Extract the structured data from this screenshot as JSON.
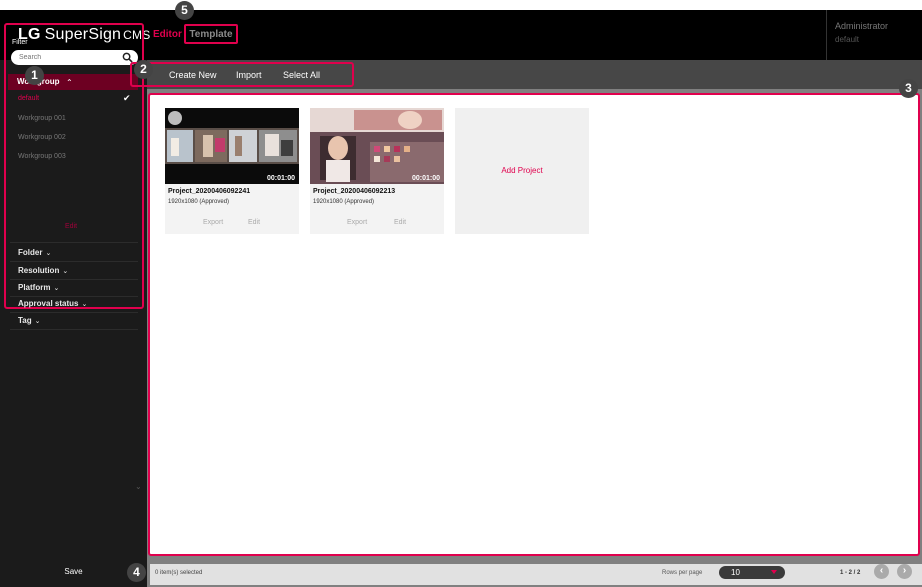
{
  "header": {
    "logo_lg": "LG",
    "logo_product": "SuperSign",
    "logo_cms": "CMS",
    "nav_editor": "Editor",
    "nav_template": "Template",
    "user_name": "Administrator",
    "user_group": "default"
  },
  "sidebar": {
    "filter_label": "Filter",
    "search_placeholder": "Search",
    "workgroup_label": "Workgroup",
    "workgroups": [
      "default",
      "Workgroup 001",
      "Workgroup 002",
      "Workgroup 003"
    ],
    "edit_label": "Edit",
    "sections": [
      "Folder",
      "Resolution",
      "Platform",
      "Approval status",
      "Tag"
    ],
    "save_label": "Save"
  },
  "toolbar": {
    "create_new": "Create New",
    "import": "Import",
    "select_all": "Select All"
  },
  "projects": [
    {
      "title": "Project_20200406092241",
      "resolution": "1920x1080 (Approved)",
      "duration": "00:01:00",
      "export": "Export",
      "edit": "Edit"
    },
    {
      "title": "Project_20200406092213",
      "resolution": "1920x1080 (Approved)",
      "duration": "00:01:00",
      "export": "Export",
      "edit": "Edit"
    }
  ],
  "add_project_label": "Add Project",
  "footer": {
    "selected_info": "0 item(s) selected",
    "rows_per_page_label": "Rows per page",
    "rows_per_page_value": "10",
    "page_info": "1 - 2 / 2"
  },
  "callouts": [
    "1",
    "2",
    "3",
    "4",
    "5"
  ],
  "colors": {
    "accent": "#e0004d",
    "header_bg": "#000000",
    "sidebar_bg": "#1b1b1b"
  }
}
